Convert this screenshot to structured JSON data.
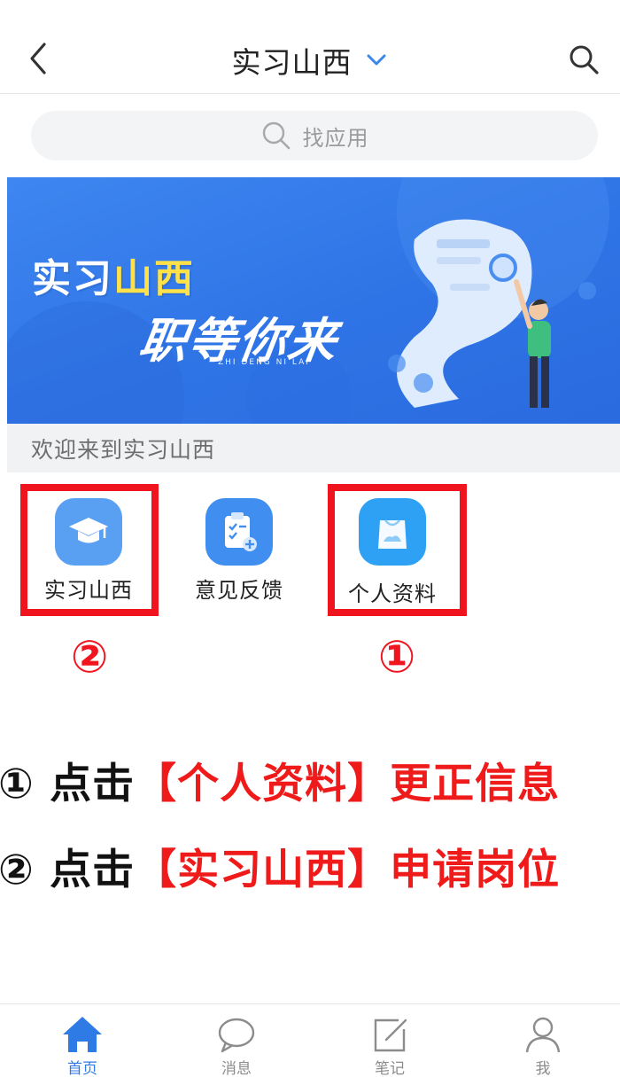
{
  "header": {
    "title": "实习山西",
    "back_icon": "chevron-left-icon",
    "dropdown_icon": "chevron-down-icon",
    "search_icon": "search-icon"
  },
  "search": {
    "placeholder": "找应用"
  },
  "banner": {
    "title_white": "实习",
    "title_yellow": "山西",
    "slogan": "职等你来",
    "pinyin": "ZHI DENG NI LAI"
  },
  "welcome_text": "欢迎来到实习山西",
  "apps": [
    {
      "label": "实习山西",
      "icon": "graduation-cap-icon",
      "color": "#5aa0f2"
    },
    {
      "label": "意见反馈",
      "icon": "clipboard-feedback-icon",
      "color": "#3f8ef0"
    },
    {
      "label": "个人资料",
      "icon": "bag-profile-icon",
      "color": "#2fa1f4"
    }
  ],
  "markers": {
    "first": "①",
    "second": "②"
  },
  "instructions": [
    {
      "num": "①",
      "verb": "点击",
      "bracket_text": "【个人资料】更正信息"
    },
    {
      "num": "②",
      "verb": "点击",
      "bracket_text": "【实习山西】申请岗位"
    }
  ],
  "bottom_nav": [
    {
      "label": "首页",
      "icon": "home-icon",
      "active": true
    },
    {
      "label": "消息",
      "icon": "chat-bubble-icon",
      "active": false
    },
    {
      "label": "笔记",
      "icon": "note-edit-icon",
      "active": false
    },
    {
      "label": "我",
      "icon": "user-icon",
      "active": false
    }
  ],
  "colors": {
    "accent": "#2f7be5",
    "highlight_red": "#f0141e",
    "banner_blue": "#3580ea"
  }
}
